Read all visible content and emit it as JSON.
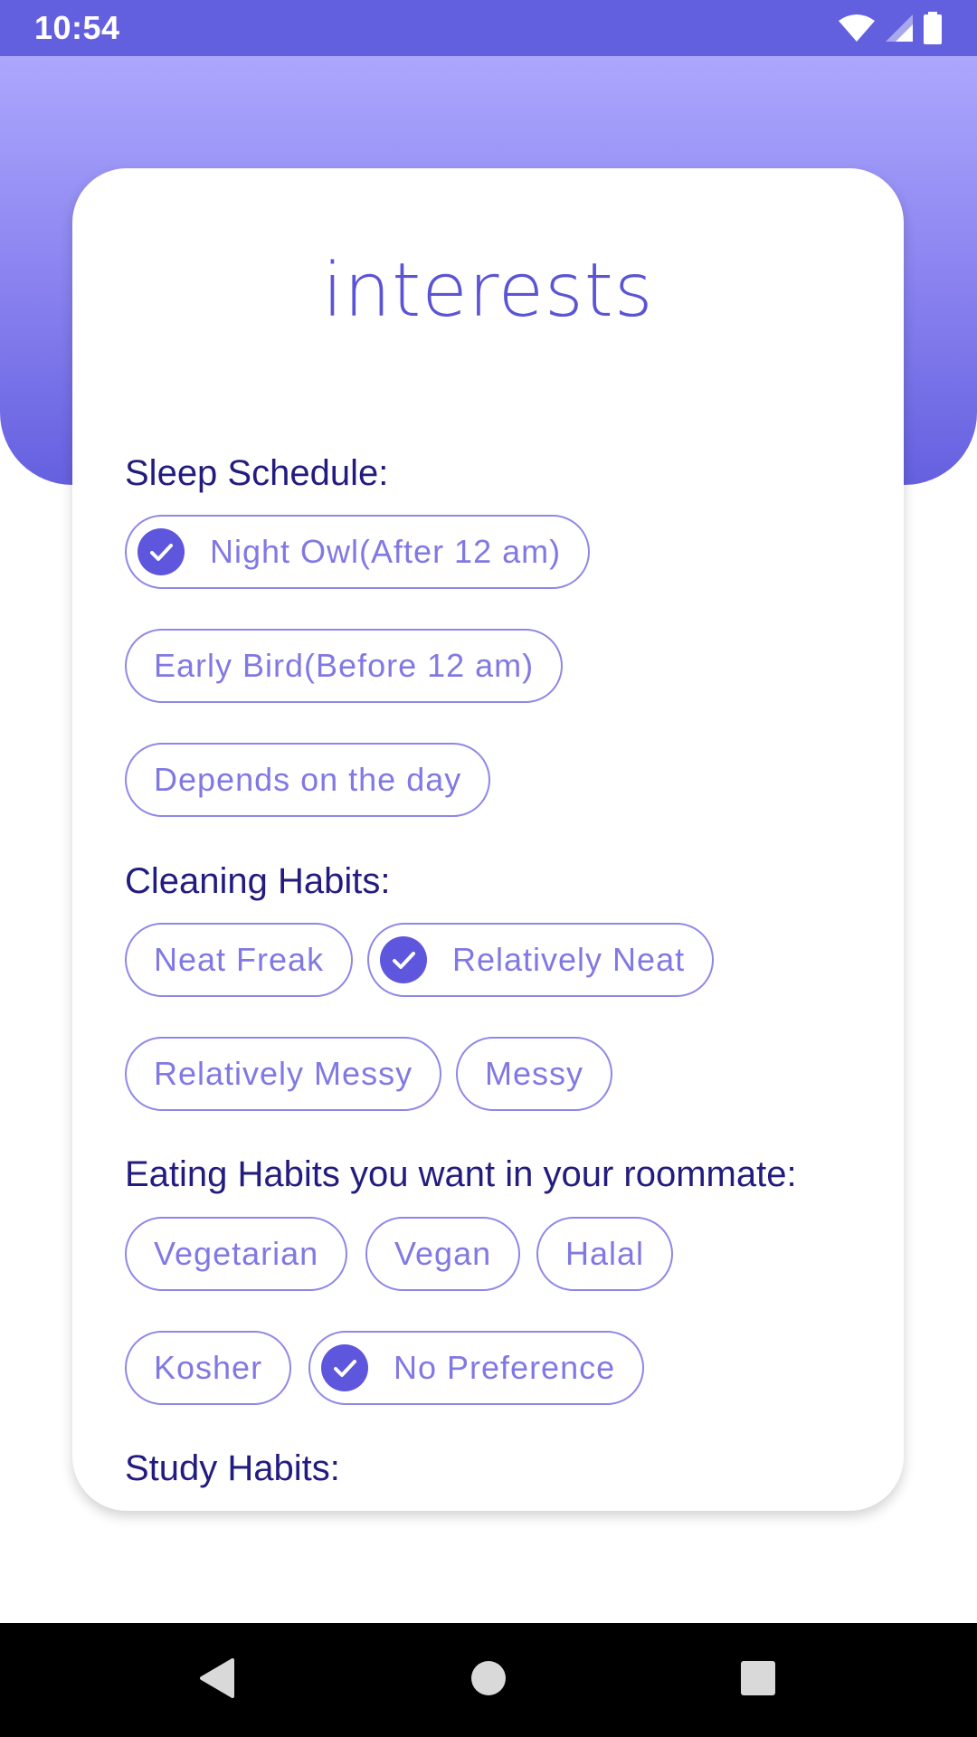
{
  "status_bar": {
    "time": "10:54",
    "icons": [
      "wifi-icon",
      "cell-signal-icon",
      "battery-icon"
    ]
  },
  "page": {
    "title": "interests"
  },
  "sections": {
    "sleep": {
      "label": "Sleep Schedule:",
      "options": [
        {
          "label": "Night Owl(After 12 am)",
          "selected": true
        },
        {
          "label": "Early Bird(Before 12 am)",
          "selected": false
        },
        {
          "label": "Depends on the day",
          "selected": false
        }
      ]
    },
    "cleaning": {
      "label": "Cleaning Habits:",
      "options": [
        {
          "label": "Neat Freak",
          "selected": false
        },
        {
          "label": "Relatively Neat",
          "selected": true
        },
        {
          "label": "Relatively Messy",
          "selected": false
        },
        {
          "label": "Messy",
          "selected": false
        }
      ]
    },
    "eating": {
      "label": "Eating Habits you want in your roommate:",
      "options": [
        {
          "label": "Vegetarian",
          "selected": false
        },
        {
          "label": "Vegan",
          "selected": false
        },
        {
          "label": "Halal",
          "selected": false
        },
        {
          "label": "Kosher",
          "selected": false
        },
        {
          "label": "No Preference",
          "selected": true
        }
      ]
    },
    "study": {
      "label": "Study Habits:"
    }
  },
  "nav_bar": {
    "buttons": [
      "back-icon",
      "home-icon",
      "recents-icon"
    ]
  },
  "colors": {
    "status_bar": "#6360df",
    "header_gradient_top": "#aca7fd",
    "header_gradient_bottom": "#6560df",
    "section_label": "#231c7f",
    "chip_text": "#8179e3",
    "chip_border": "#8f87e8",
    "check_fill": "#5e56dc",
    "title": "#5b54d4"
  }
}
